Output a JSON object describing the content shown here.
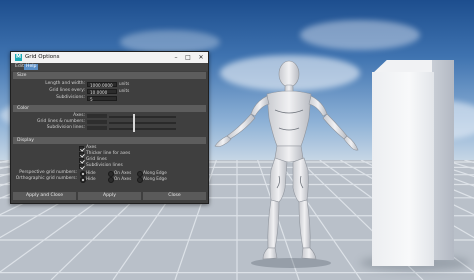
{
  "window": {
    "title": "Grid Options",
    "app_icon": "M",
    "controls": [
      "minimize-icon",
      "maximize-icon",
      "close-icon"
    ]
  },
  "menu": [
    "Edit",
    "Help"
  ],
  "sections": {
    "size": "Size",
    "color": "Color",
    "display": "Display"
  },
  "size": {
    "length_label": "Length and width:",
    "length_value": "1000.0000",
    "length_unit": "units",
    "lines_label": "Grid lines every:",
    "lines_value": "10.0000",
    "lines_unit": "units",
    "subdiv_label": "Subdivisions:",
    "subdiv_value": "5"
  },
  "color": {
    "axes_label": "Axes:",
    "axes_level": 0.37,
    "lines_label": "Grid lines & numbers:",
    "lines_level": 0.37,
    "subdiv_label": "Subdivision lines:",
    "subdiv_level": 0.37
  },
  "display": {
    "checkboxes": [
      "Axes",
      "Thicker line for axes",
      "Grid lines",
      "Subdivision lines"
    ],
    "persp_label": "Perspective grid numbers:",
    "ortho_label": "Orthographic grid numbers:",
    "radio_options": [
      "Hide",
      "On Axes",
      "Along Edge"
    ],
    "persp_selected": 0,
    "ortho_selected": 0
  },
  "buttons": {
    "apply_close": "Apply and Close",
    "apply": "Apply",
    "close": "Close"
  },
  "colors": {
    "accent": "#5b8fc7",
    "dialog_bg": "#3f3f3f",
    "app_icon": "#1ba9b5"
  }
}
